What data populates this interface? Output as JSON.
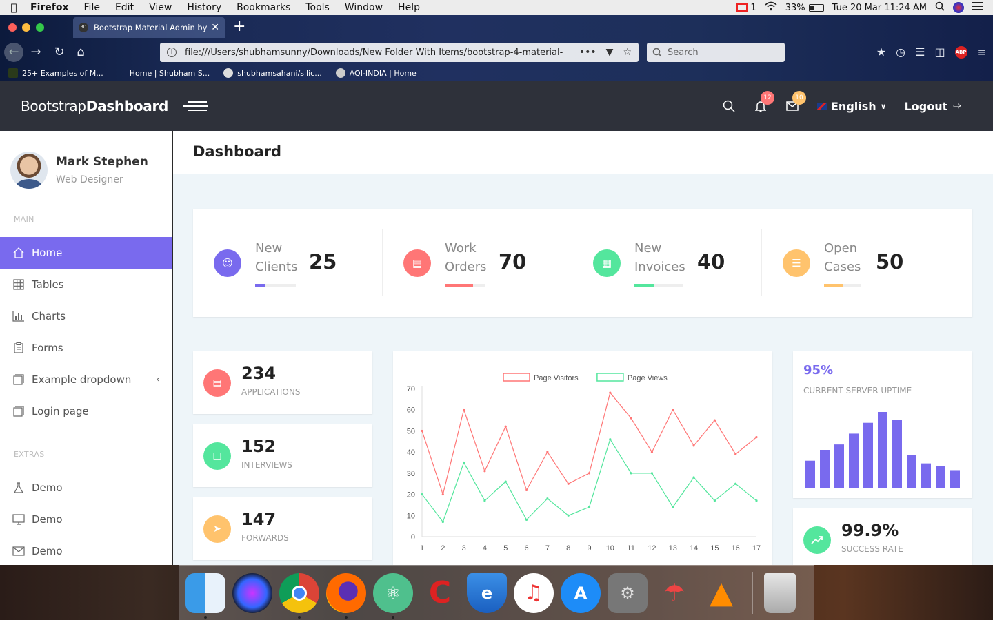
{
  "menubar": {
    "app": "Firefox",
    "items": [
      "File",
      "Edit",
      "View",
      "History",
      "Bookmarks",
      "Tools",
      "Window",
      "Help"
    ],
    "mail_count": "1",
    "battery": "33%",
    "datetime": "Tue 20 Mar  11:24 AM"
  },
  "browser": {
    "tab_title": "Bootstrap Material Admin by Bo",
    "tab_favicon": "BD",
    "url": "file:///Users/shubhamsunny/Downloads/New Folder With Items/bootstrap-4-material-",
    "search_placeholder": "Search",
    "bookmarks": [
      "25+ Examples of M...",
      "Home | Shubham S...",
      "shubhamsahani/silic...",
      "AQI-INDIA | Home"
    ],
    "abp": "ABP"
  },
  "header": {
    "brand_light": "Bootstrap",
    "brand_bold": "Dashboard",
    "notifications": "12",
    "messages": "10",
    "language": "English",
    "logout": "Logout"
  },
  "sidebar": {
    "user_name": "Mark Stephen",
    "user_role": "Web Designer",
    "main_title": "MAIN",
    "main_items": [
      "Home",
      "Tables",
      "Charts",
      "Forms",
      "Example dropdown",
      "Login page"
    ],
    "extras_title": "EXTRAS",
    "extras_items": [
      "Demo",
      "Demo",
      "Demo"
    ]
  },
  "page": {
    "title": "Dashboard"
  },
  "stats": [
    {
      "label1": "New",
      "label2": "Clients",
      "value": "25",
      "progress": 0.25,
      "color": "#796aee"
    },
    {
      "label1": "Work",
      "label2": "Orders",
      "value": "70",
      "progress": 0.7,
      "color": "#ff7676"
    },
    {
      "label1": "New",
      "label2": "Invoices",
      "value": "40",
      "progress": 0.4,
      "color": "#54e69d"
    },
    {
      "label1": "Open",
      "label2": "Cases",
      "value": "50",
      "progress": 0.5,
      "color": "#ffc36d"
    }
  ],
  "mini_stats": [
    {
      "value": "234",
      "caption": "APPLICATIONS",
      "color": "#ff7676"
    },
    {
      "value": "152",
      "caption": "INTERVIEWS",
      "color": "#54e69d"
    },
    {
      "value": "147",
      "caption": "FORWARDS",
      "color": "#ffc36d"
    }
  ],
  "uptime": {
    "value": "95%",
    "caption": "CURRENT SERVER UPTIME"
  },
  "success": {
    "value": "99.9%",
    "caption": "SUCCESS RATE"
  },
  "dock_apps": [
    "Finder",
    "Siri",
    "Chrome",
    "Firefox",
    "Atom",
    "CCleaner",
    "Edge",
    "iTunes",
    "App Store",
    "System Preferences",
    "Transmit",
    "VLC",
    "Trash"
  ],
  "chart_data": [
    {
      "type": "line",
      "title": "",
      "x": [
        1,
        2,
        3,
        4,
        5,
        6,
        7,
        8,
        9,
        10,
        11,
        12,
        13,
        14,
        15,
        16,
        17
      ],
      "series": [
        {
          "name": "Page Visitors",
          "color": "#ff7676",
          "values": [
            50,
            20,
            60,
            31,
            52,
            22,
            40,
            25,
            30,
            68,
            56,
            40,
            60,
            43,
            55,
            39,
            47
          ]
        },
        {
          "name": "Page Views",
          "color": "#54e69d",
          "values": [
            20,
            7,
            35,
            17,
            26,
            8,
            18,
            10,
            14,
            46,
            30,
            30,
            14,
            28,
            17,
            25,
            17
          ]
        }
      ],
      "ylim": [
        0,
        70
      ],
      "yticks": [
        0,
        10,
        20,
        30,
        40,
        50,
        60,
        70
      ],
      "grid": true,
      "legend": "top-center"
    },
    {
      "type": "bar",
      "title": "",
      "categories": [
        "1",
        "2",
        "3",
        "4",
        "5",
        "6",
        "7",
        "8",
        "9",
        "10",
        "11",
        "12"
      ],
      "values": [
        20,
        28,
        32,
        40,
        48,
        56,
        50,
        24,
        18,
        16,
        13,
        0
      ],
      "color": "#796aee",
      "ylim": [
        0,
        56
      ],
      "axes_visible": false
    }
  ]
}
